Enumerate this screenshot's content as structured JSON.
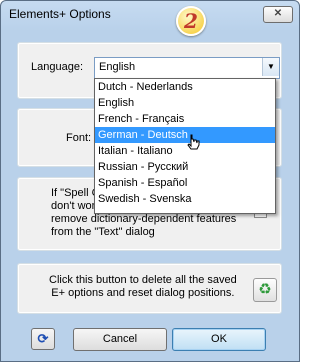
{
  "window": {
    "title": "Elements+ Options",
    "close_label": "✕"
  },
  "badge": {
    "text": "2"
  },
  "language": {
    "label": "Language:",
    "selected": "English",
    "options": [
      "Dutch - Nederlands",
      "English",
      "French - Français",
      "German - Deutsch",
      "Italian - Italiano",
      "Russian - Русский",
      "Spanish - Español",
      "Swedish - Svenska"
    ],
    "highlighted": "German - Deutsch"
  },
  "font": {
    "label": "Font:"
  },
  "spell_check": {
    "lines": [
      "If \"Spell C",
      "don't work for you, uncheck this box to",
      "remove dictionary-dependent features",
      "from the \"Text\" dialog"
    ]
  },
  "reset": {
    "lines": [
      "Click this button to delete all the saved",
      "E+ options and reset dialog positions."
    ]
  },
  "buttons": {
    "cancel": "Cancel",
    "ok": "OK"
  },
  "icons": {
    "refresh": "refresh-icon",
    "recycle": "recycle-icon",
    "dropdown_arrow": "chevron-down-icon",
    "cursor": "mouse-cursor-icon"
  }
}
